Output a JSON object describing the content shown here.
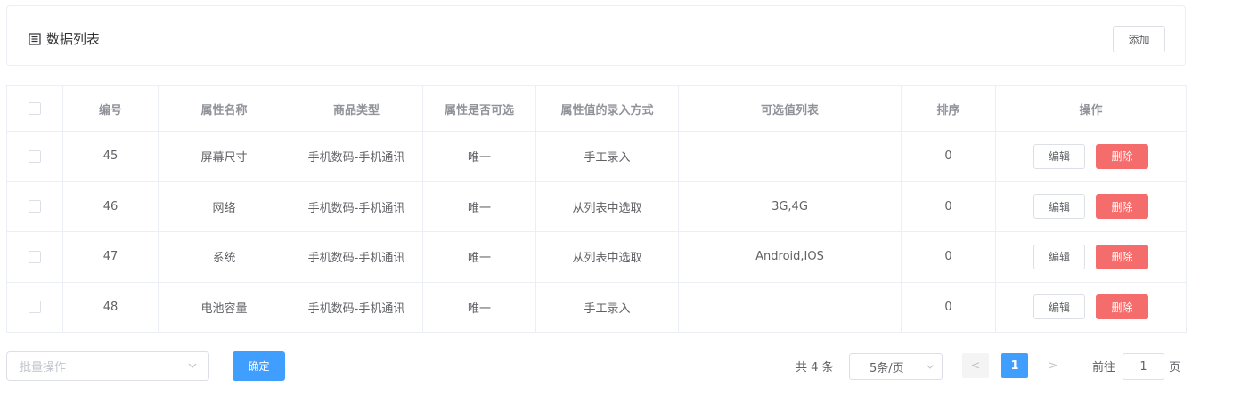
{
  "header": {
    "title": "数据列表",
    "add_label": "添加"
  },
  "table": {
    "columns": [
      "",
      "编号",
      "属性名称",
      "商品类型",
      "属性是否可选",
      "属性值的录入方式",
      "可选值列表",
      "排序",
      "操作"
    ],
    "rows": [
      {
        "id": "45",
        "name": "屏幕尺寸",
        "type": "手机数码-手机通讯",
        "selectable": "唯一",
        "input_mode": "手工录入",
        "options": "",
        "sort": "0"
      },
      {
        "id": "46",
        "name": "网络",
        "type": "手机数码-手机通讯",
        "selectable": "唯一",
        "input_mode": "从列表中选取",
        "options": "3G,4G",
        "sort": "0"
      },
      {
        "id": "47",
        "name": "系统",
        "type": "手机数码-手机通讯",
        "selectable": "唯一",
        "input_mode": "从列表中选取",
        "options": "Android,IOS",
        "sort": "0"
      },
      {
        "id": "48",
        "name": "电池容量",
        "type": "手机数码-手机通讯",
        "selectable": "唯一",
        "input_mode": "手工录入",
        "options": "",
        "sort": "0"
      }
    ],
    "edit_label": "编辑",
    "delete_label": "删除"
  },
  "batch": {
    "placeholder": "批量操作",
    "confirm_label": "确定"
  },
  "pagination": {
    "total_text": "共 4 条",
    "page_size": "5条/页",
    "prev": "<",
    "current_page": "1",
    "next": ">",
    "goto_prefix": "前往",
    "goto_value": "1",
    "goto_suffix": "页"
  },
  "colors": {
    "primary": "#409eff",
    "danger": "#f56c6c",
    "border": "#ebeef5"
  }
}
